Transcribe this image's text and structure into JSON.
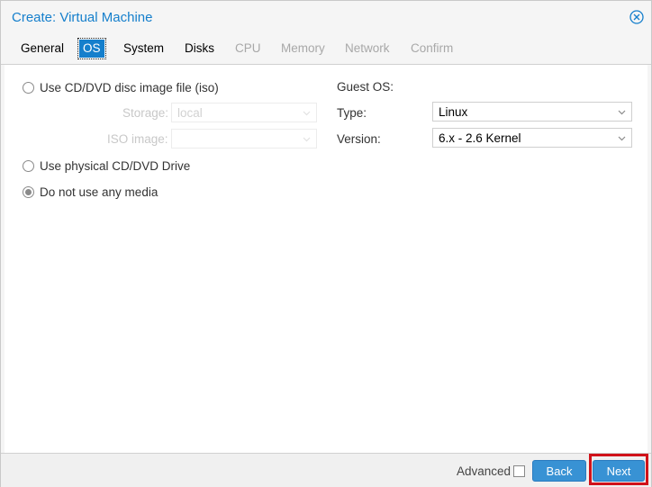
{
  "window": {
    "title": "Create: Virtual Machine",
    "close_icon": "circle-x-icon"
  },
  "tabs": [
    {
      "label": "General",
      "state": "normal"
    },
    {
      "label": "OS",
      "state": "active"
    },
    {
      "label": "System",
      "state": "normal"
    },
    {
      "label": "Disks",
      "state": "normal"
    },
    {
      "label": "CPU",
      "state": "disabled"
    },
    {
      "label": "Memory",
      "state": "disabled"
    },
    {
      "label": "Network",
      "state": "disabled"
    },
    {
      "label": "Confirm",
      "state": "disabled"
    }
  ],
  "media": {
    "iso_option": {
      "label": "Use CD/DVD disc image file (iso)",
      "checked": false
    },
    "storage": {
      "label": "Storage:",
      "value": "local",
      "disabled": true
    },
    "iso_image": {
      "label": "ISO image:",
      "value": "",
      "disabled": true
    },
    "physical_option": {
      "label": "Use physical CD/DVD Drive",
      "checked": false
    },
    "no_media_option": {
      "label": "Do not use any media",
      "checked": true
    }
  },
  "guest_os": {
    "heading": "Guest OS:",
    "type": {
      "label": "Type:",
      "value": "Linux"
    },
    "version": {
      "label": "Version:",
      "value": "6.x - 2.6 Kernel"
    }
  },
  "footer": {
    "advanced_label": "Advanced",
    "advanced_checked": false,
    "back_label": "Back",
    "next_label": "Next"
  },
  "colors": {
    "accent": "#157fcc",
    "button": "#3892d4",
    "highlight": "#d0121a"
  }
}
